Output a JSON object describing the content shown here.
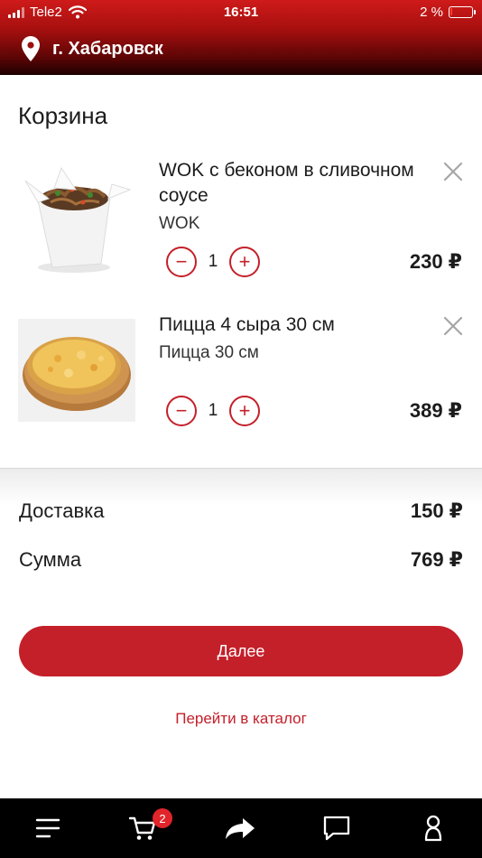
{
  "status_bar": {
    "carrier": "Tele2",
    "time": "16:51",
    "battery": "2 %"
  },
  "header": {
    "city": "г. Хабаровск"
  },
  "cart": {
    "title": "Корзина",
    "items": [
      {
        "name": "WOK с беконом в сливочном соусе",
        "category": "WOK",
        "quantity": "1",
        "price": "230 ₽",
        "minus": "−",
        "plus": "+"
      },
      {
        "name": "Пицца 4 сыра 30 см",
        "category": "Пицца 30 см",
        "quantity": "1",
        "price": "389 ₽",
        "minus": "−",
        "plus": "+"
      }
    ]
  },
  "summary": {
    "delivery_label": "Доставка",
    "delivery_value": "150 ₽",
    "total_label": "Сумма",
    "total_value": "769 ₽"
  },
  "actions": {
    "next": "Далее",
    "catalog": "Перейти в каталог"
  },
  "tabbar": {
    "cart_badge": "2",
    "icons": [
      "menu-icon",
      "cart-icon",
      "share-icon",
      "chat-icon",
      "profile-icon"
    ]
  },
  "colors": {
    "accent": "#c4202a",
    "header": "#a8100f",
    "tabbar": "#000000"
  }
}
